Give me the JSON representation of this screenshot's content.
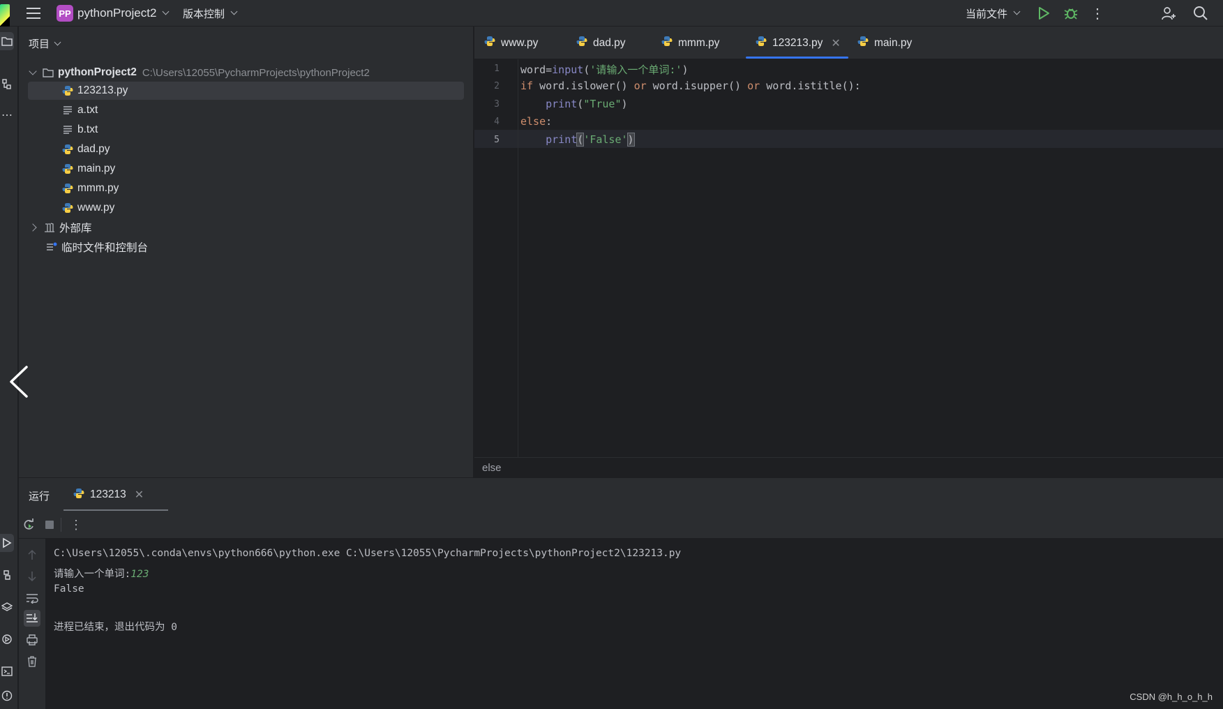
{
  "titlebar": {
    "project_badge": "PP",
    "project_name": "pythonProject2",
    "vcs_label": "版本控制",
    "run_config": "当前文件"
  },
  "project_panel": {
    "header": "项目",
    "root_name": "pythonProject2",
    "root_path": "C:\\Users\\12055\\PycharmProjects\\pythonProject2",
    "files": [
      {
        "name": "123213.py",
        "type": "python"
      },
      {
        "name": "a.txt",
        "type": "text"
      },
      {
        "name": "b.txt",
        "type": "text"
      },
      {
        "name": "dad.py",
        "type": "python"
      },
      {
        "name": "main.py",
        "type": "python"
      },
      {
        "name": "mmm.py",
        "type": "python"
      },
      {
        "name": "www.py",
        "type": "python"
      }
    ],
    "external_libs": "外部库",
    "scratches": "临时文件和控制台"
  },
  "tabs": [
    {
      "label": "www.py"
    },
    {
      "label": "dad.py"
    },
    {
      "label": "mmm.py"
    },
    {
      "label": "123213.py",
      "active": true
    },
    {
      "label": "main.py"
    }
  ],
  "editor": {
    "line_numbers": [
      "1",
      "2",
      "3",
      "4",
      "5"
    ],
    "current_line": 5,
    "code": {
      "l1_a": "word",
      "l1_b": "=",
      "l1_c": "input",
      "l1_d": "(",
      "l1_e": "'请输入一个单词:'",
      "l1_f": ")",
      "l2_if": "if",
      "l2_a": " word.islower() ",
      "l2_or1": "or",
      "l2_b": " word.isupper() ",
      "l2_or2": "or",
      "l2_c": " word.istitle():",
      "l3_indent": "    ",
      "l3_print": "print",
      "l3_p1": "(",
      "l3_str": "\"True\"",
      "l3_p2": ")",
      "l4_else": "else",
      "l4_colon": ":",
      "l5_indent": "    ",
      "l5_print": "print",
      "l5_p1": "(",
      "l5_str": "'False'",
      "l5_p2": ")"
    },
    "breadcrumb": "else"
  },
  "run_panel": {
    "label": "运行",
    "tab": "123213",
    "console": {
      "cmd": "C:\\Users\\12055\\.conda\\envs\\python666\\python.exe C:\\Users\\12055\\PycharmProjects\\pythonProject2\\123213.py",
      "prompt": "请输入一个单词:",
      "input": "123",
      "output": "False",
      "exit": "进程已结束，退出代码为 0"
    }
  },
  "watermark": "CSDN @h_h_o_h_h",
  "colors": {
    "accent": "#3574f0",
    "keyword": "#cf8e6d",
    "string": "#6aab73",
    "builtin": "#8888c6",
    "run_green": "#5fb865"
  }
}
